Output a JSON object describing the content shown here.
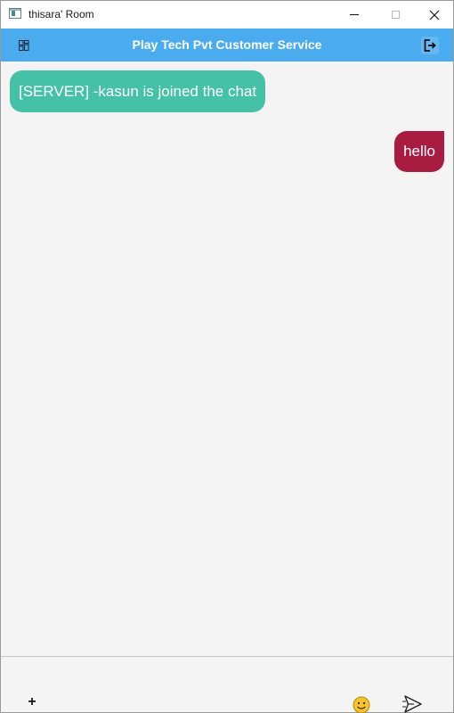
{
  "window": {
    "title": "thisara' Room",
    "icon": "app-window-icon",
    "controls": [
      "minimize-icon",
      "maximize-icon",
      "close-icon"
    ]
  },
  "header": {
    "title": "Play Tech Pvt Customer Service",
    "left_icon": "menu-grid-icon",
    "right_icon": "logout-icon",
    "background": "#4aabef"
  },
  "messages": [
    {
      "sender": "server",
      "text": "[SERVER] -kasun is joined the chat",
      "color": "#45c1a7"
    },
    {
      "sender": "self",
      "text": "hello",
      "color": "#a81c41"
    }
  ],
  "input_bar": {
    "attach_label": "+",
    "emoji_icon": "emoji-icon",
    "send_icon": "send-icon"
  }
}
